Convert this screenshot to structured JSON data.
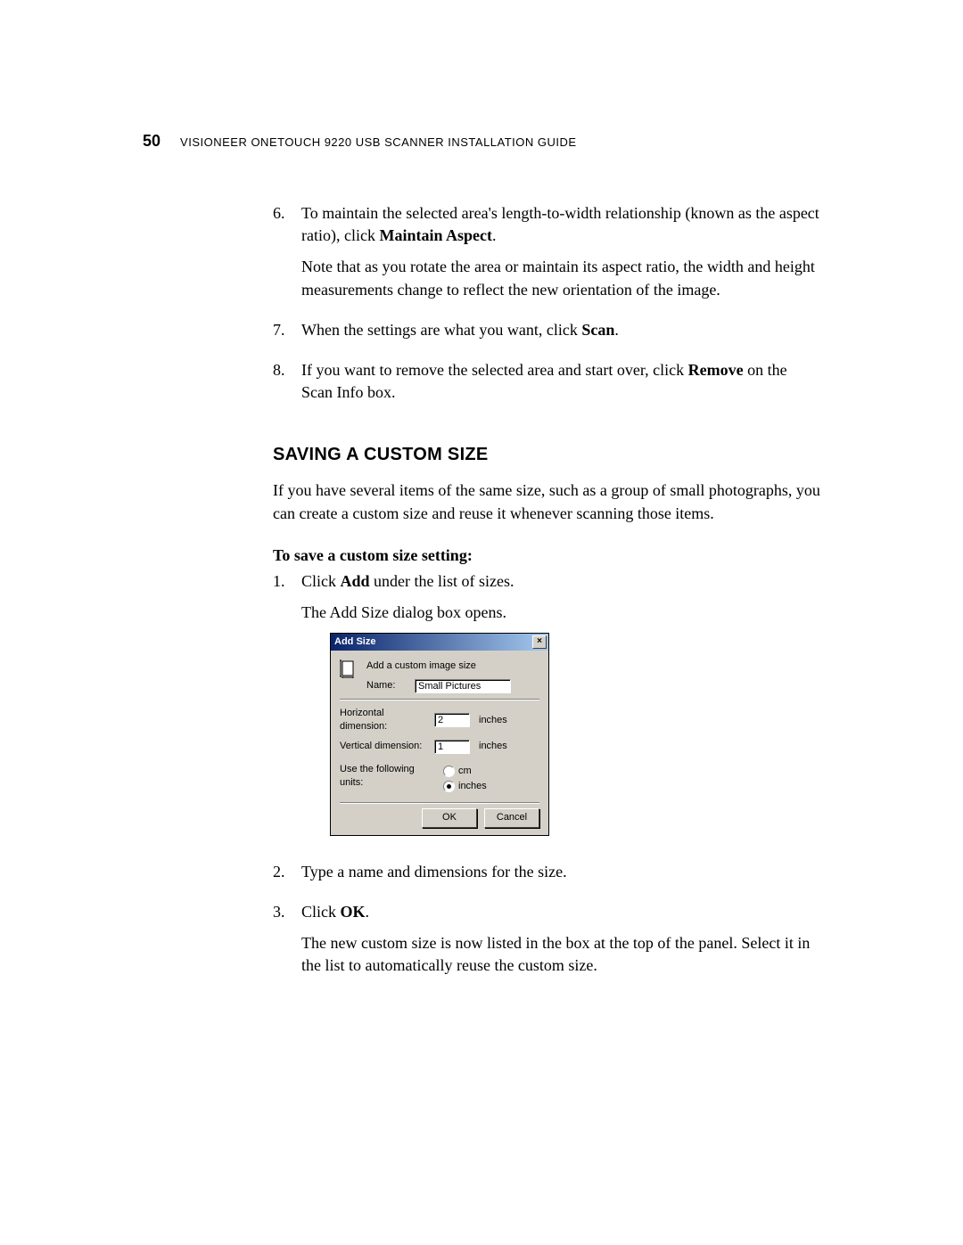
{
  "header": {
    "page_number": "50",
    "title": "VISIONEER ONETOUCH 9220 USB SCANNER INSTALLATION GUIDE"
  },
  "list1": {
    "item6_num": "6.",
    "item6_text_a": "To maintain the selected area's length-to-width relationship (known as the aspect ratio), click ",
    "item6_bold": "Maintain Aspect",
    "item6_text_b": ".",
    "item6_para2": "Note that as you rotate the area or maintain its aspect ratio, the width and height measurements change to reflect the new orientation of the image.",
    "item7_num": "7.",
    "item7_text_a": "When the settings are what you want, click ",
    "item7_bold": "Scan",
    "item7_text_b": ".",
    "item8_num": "8.",
    "item8_text_a": "If you want to remove the selected area and start over, click ",
    "item8_bold": "Remove",
    "item8_text_b": " on the Scan Info box."
  },
  "section_heading": "SAVING A CUSTOM SIZE",
  "intro_para": "If you have several items of the same size, such as a group of small photographs, you can create a custom size and reuse it whenever scanning those items.",
  "sub_heading": "To save a custom size setting:",
  "list2": {
    "item1_num": "1.",
    "item1_text_a": "Click ",
    "item1_bold": "Add",
    "item1_text_b": " under the list of sizes.",
    "item1_para2": "The Add Size dialog box opens.",
    "item2_num": "2.",
    "item2_text": "Type a name and dimensions for the size.",
    "item3_num": "3.",
    "item3_text_a": "Click ",
    "item3_bold": "OK",
    "item3_text_b": ".",
    "item3_para2": "The new custom size is now listed in the box at the top of the panel. Select it in the list to automatically reuse the custom size."
  },
  "dialog": {
    "title": "Add Size",
    "heading": "Add a custom image size",
    "name_label": "Name:",
    "name_value": "Small Pictures",
    "hdim_label": "Horizontal dimension:",
    "hdim_value": "2",
    "vdim_label": "Vertical dimension:",
    "vdim_value": "1",
    "unit_suffix": "inches",
    "units_label": "Use the following units:",
    "radio_cm": "cm",
    "radio_inches": "inches",
    "ok": "OK",
    "cancel": "Cancel"
  }
}
